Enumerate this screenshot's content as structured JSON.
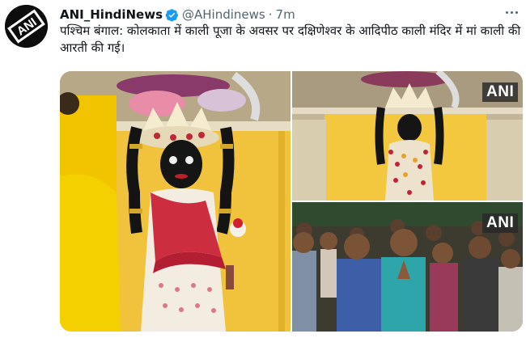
{
  "tweet": {
    "author_name": "ANI_HindiNews",
    "handle": "@AHindinews",
    "separator": "·",
    "time": "7m",
    "text": "पश्चिम बंगाल: कोलकाता में काली पूजा के अवसर पर दक्षिणेश्वर के आदिपीठ काली मंदिर में मां काली की आरती की गई।"
  },
  "avatar": {
    "logo_text": "ANI"
  },
  "media": {
    "watermark": "ANI"
  },
  "colors": {
    "verified_badge": "#1d9bf0",
    "text_primary": "#0f1419",
    "text_secondary": "#536471"
  },
  "icons": [
    "verified-badge-icon",
    "more-options-icon"
  ]
}
